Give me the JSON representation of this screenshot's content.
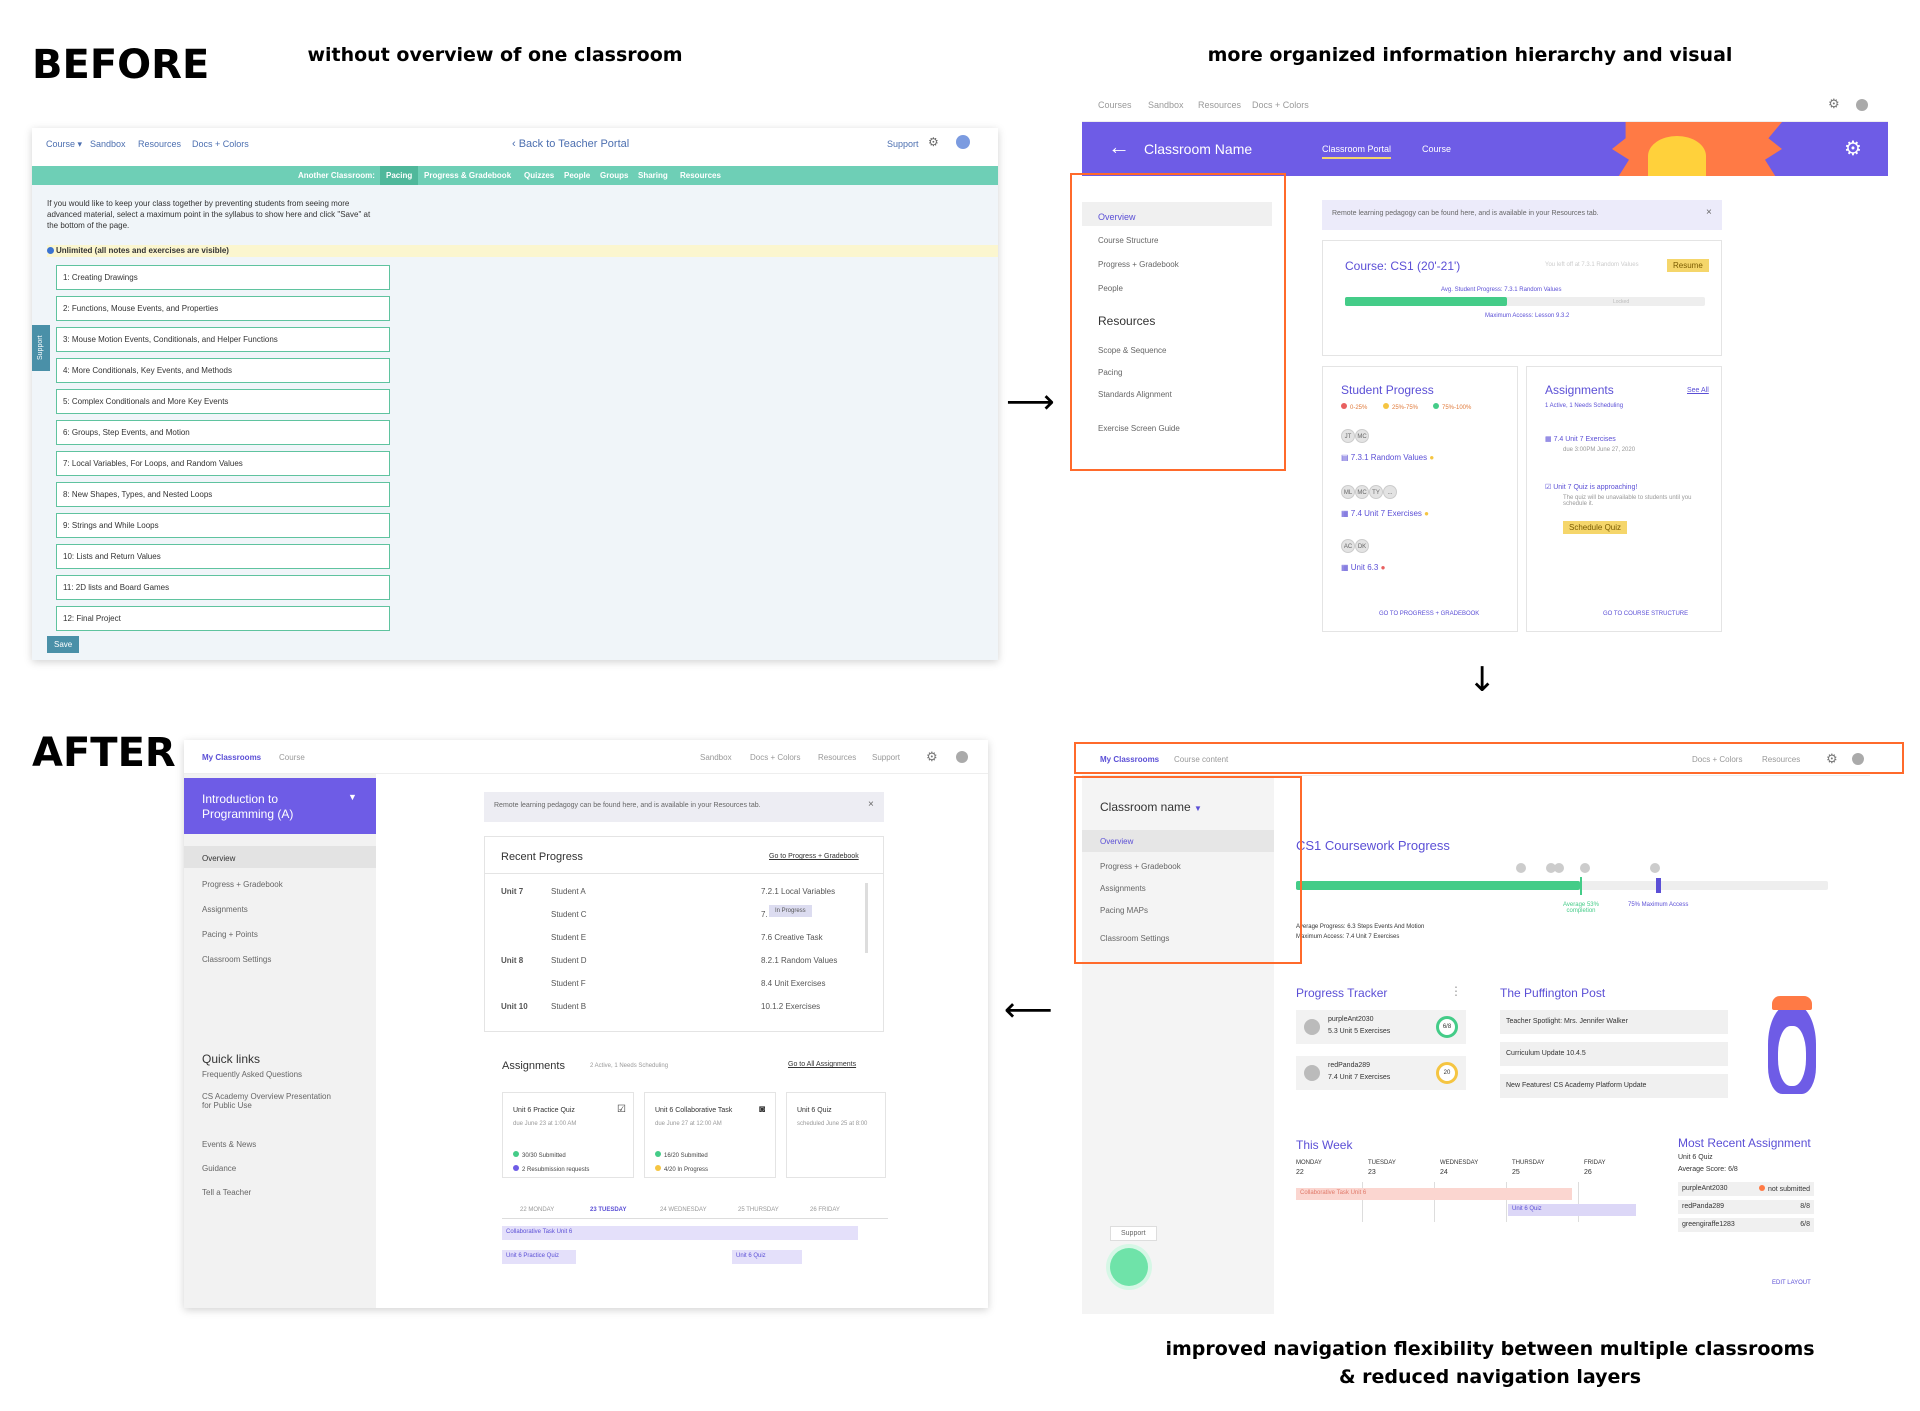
{
  "headings": {
    "before": "BEFORE",
    "after": "AFTER"
  },
  "captions": {
    "before_left": "without overview of one classroom",
    "before_right": "more organized information hierarchy and visual",
    "after_right_1": "improved navigation flexibility between multiple classrooms",
    "after_right_2": "& reduced navigation layers"
  },
  "old_page": {
    "nav": {
      "course": "Course ▾",
      "sandbox": "Sandbox",
      "resources": "Resources",
      "docs": "Docs + Colors",
      "back": "‹ Back to Teacher Portal",
      "support": "Support"
    },
    "tabbar": {
      "label": "Another Classroom:",
      "tabs": [
        "Pacing",
        "Progress & Gradebook",
        "Quizzes",
        "People",
        "Groups",
        "Sharing",
        "Resources"
      ]
    },
    "intro": "If you would like to keep your class together by preventing students from seeing more advanced material, select a maximum point in the syllabus to show here and click \"Save\" at the bottom of the page.",
    "unlimited": "Unlimited (all notes and exercises are visible)",
    "units": [
      "1: Creating Drawings",
      "2: Functions, Mouse Events, and Properties",
      "3: Mouse Motion Events, Conditionals, and Helper Functions",
      "4: More Conditionals, Key Events, and Methods",
      "5: Complex Conditionals and More Key Events",
      "6: Groups, Step Events, and Motion",
      "7: Local Variables, For Loops, and Random Values",
      "8: New Shapes, Types, and Nested Loops",
      "9: Strings and While Loops",
      "10: Lists and Return Values",
      "11: 2D lists and Board Games",
      "12: Final Project"
    ],
    "save": "Save",
    "support_tab": "Support"
  },
  "mid_page": {
    "nav": {
      "courses": "Courses",
      "sandbox": "Sandbox",
      "resources": "Resources",
      "docs": "Docs + Colors"
    },
    "banner": {
      "back": "←",
      "title": "Classroom Name",
      "tab1": "Classroom Portal",
      "tab2": "Course"
    },
    "sidebar": {
      "items": [
        "Overview",
        "Course Structure",
        "Progress + Gradebook",
        "People"
      ],
      "resources_title": "Resources",
      "resources": [
        "Scope & Sequence",
        "Pacing",
        "Standards Alignment",
        "Exercise Screen Guide"
      ]
    },
    "notice": "Remote learning pedagogy can be found here, and is available in your Resources tab.",
    "course": {
      "title": "Course: CS1 (20'-21')",
      "left_off": "You left off at 7.3.1 Random Values",
      "resume": "Resume",
      "avg": "Avg. Student Progress: 7.3.1 Random Values",
      "locked": "Locked",
      "max": "Maximum Access: Lesson 9.3.2"
    },
    "student_progress": {
      "title": "Student Progress",
      "legend": [
        "0-25%",
        "25%-75%",
        "75%-100%"
      ],
      "items": [
        "7.3.1 Random Values",
        "7.4 Unit 7 Exercises",
        "Unit 6.3"
      ],
      "avatars1": [
        "JT",
        "MC"
      ],
      "avatars2": [
        "ML",
        "MC",
        "TY",
        "..."
      ],
      "avatars3": [
        "AC",
        "DK"
      ],
      "link": "GO TO PROGRESS + GRADEBOOK"
    },
    "assignments": {
      "title": "Assignments",
      "see_all": "See All",
      "sub": "1 Active, 1 Needs Scheduling",
      "item1": "7.4 Unit 7 Exercises",
      "item1_due": "due 3:00PM June 27, 2020",
      "item2": "Unit 7 Quiz is approaching!",
      "item2_desc": "The quiz will be unavailable to students until you schedule it.",
      "schedule": "Schedule Quiz",
      "link": "GO TO COURSE STRUCTURE"
    }
  },
  "final_page": {
    "nav": {
      "my_classrooms": "My Classrooms",
      "course": "Course",
      "sandbox": "Sandbox",
      "docs": "Docs + Colors",
      "resources": "Resources",
      "support": "Support"
    },
    "class_title": "Introduction to Programming (A)",
    "sidebar": [
      "Overview",
      "Progress + Gradebook",
      "Assignments",
      "Pacing + Points",
      "Classroom Settings"
    ],
    "quick_title": "Quick links",
    "quick": [
      "Frequently Asked Questions",
      "CS Academy Overview Presentation for Public Use",
      "Events & News",
      "Guidance",
      "Tell a Teacher"
    ],
    "notice": "Remote learning pedagogy can be found here, and is available in your Resources tab.",
    "recent": {
      "title": "Recent Progress",
      "link": "Go to Progress + Gradebook",
      "rows": [
        [
          "Unit 7",
          "Student A",
          "7.2.1 Local Variables"
        ],
        [
          "",
          "Student C",
          "7."
        ],
        [
          "",
          "Student E",
          "7.6 Creative Task"
        ],
        [
          "Unit 8",
          "Student D",
          "8.2.1 Random Values"
        ],
        [
          "",
          "Student F",
          "8.4 Unit Exercises"
        ],
        [
          "Unit 10",
          "Student B",
          "10.1.2 Exercises"
        ]
      ],
      "tooltip": "In Progress"
    },
    "assign": {
      "title": "Assignments",
      "sub": "2 Active, 1 Needs Scheduling",
      "link": "Go to All Assignments",
      "cards": [
        {
          "title": "Unit 6 Practice Quiz",
          "due": "due June 23 at 1:00 AM",
          "s1": "30/30 Submitted",
          "s2": "2 Resubmission requests"
        },
        {
          "title": "Unit 6 Collaborative Task",
          "due": "due June 27 at 12:00 AM",
          "s1": "16/20 Submitted",
          "s2": "4/20 In Progress"
        },
        {
          "title": "Unit 6 Quiz",
          "due": "scheduled June 25 at 8:00",
          "s1": "",
          "s2": ""
        }
      ]
    },
    "days": [
      "22 MONDAY",
      "23 TUESDAY",
      "24 WEDNESDAY",
      "25 THURSDAY",
      "26 FRIDAY"
    ],
    "events": [
      "Collaborative Task Unit 6",
      "Unit 6 Practice Quiz",
      "Unit 6 Quiz"
    ]
  },
  "proto_page": {
    "nav": {
      "my_classrooms": "My Classrooms",
      "course_content": "Course content",
      "docs": "Docs + Colors",
      "resources": "Resources"
    },
    "class_name": "Classroom name",
    "sidebar": [
      "Overview",
      "Progress + Gradebook",
      "Assignments",
      "Pacing MAPs",
      "Classroom Settings"
    ],
    "support": "Support",
    "coursework": {
      "title": "CS1 Coursework Progress",
      "avg_label": "Average 53% completion",
      "max_label": "75% Maximum Access",
      "avg_text": "Average Progress: 6.3 Steps Events And Motion",
      "max_text": "Maximum Access: 7.4 Unit 7 Exercises"
    },
    "tracker": {
      "title": "Progress Tracker",
      "items": [
        {
          "name": "purpleAnt2030",
          "task": "5.3 Unit 5 Exercises",
          "score": "6/8"
        },
        {
          "name": "redPanda289",
          "task": "7.4 Unit 7 Exercises",
          "score": "20"
        }
      ]
    },
    "post": {
      "title": "The Puffington Post",
      "items": [
        "Teacher Spotlight: Mrs. Jennifer Walker",
        "Curriculum Update 10.4.5",
        "New Features! CS Academy Platform Update"
      ]
    },
    "week": {
      "title": "This Week",
      "days": [
        [
          "MONDAY",
          "22"
        ],
        [
          "TUESDAY",
          "23"
        ],
        [
          "WEDNESDAY",
          "24"
        ],
        [
          "THURSDAY",
          "25"
        ],
        [
          "FRIDAY",
          "26"
        ]
      ],
      "events": [
        "Collaborative Task Unit 6",
        "Unit 6 Quiz"
      ]
    },
    "recent": {
      "title": "Most Recent Assignment",
      "name": "Unit 6 Quiz",
      "avg": "Average Score: 6/8",
      "rows": [
        [
          "purpleAnt2030",
          "not submitted"
        ],
        [
          "redPanda289",
          "8/8"
        ],
        [
          "greengiraffe1283",
          "6/8"
        ]
      ]
    },
    "edit": "EDIT LAYOUT"
  }
}
